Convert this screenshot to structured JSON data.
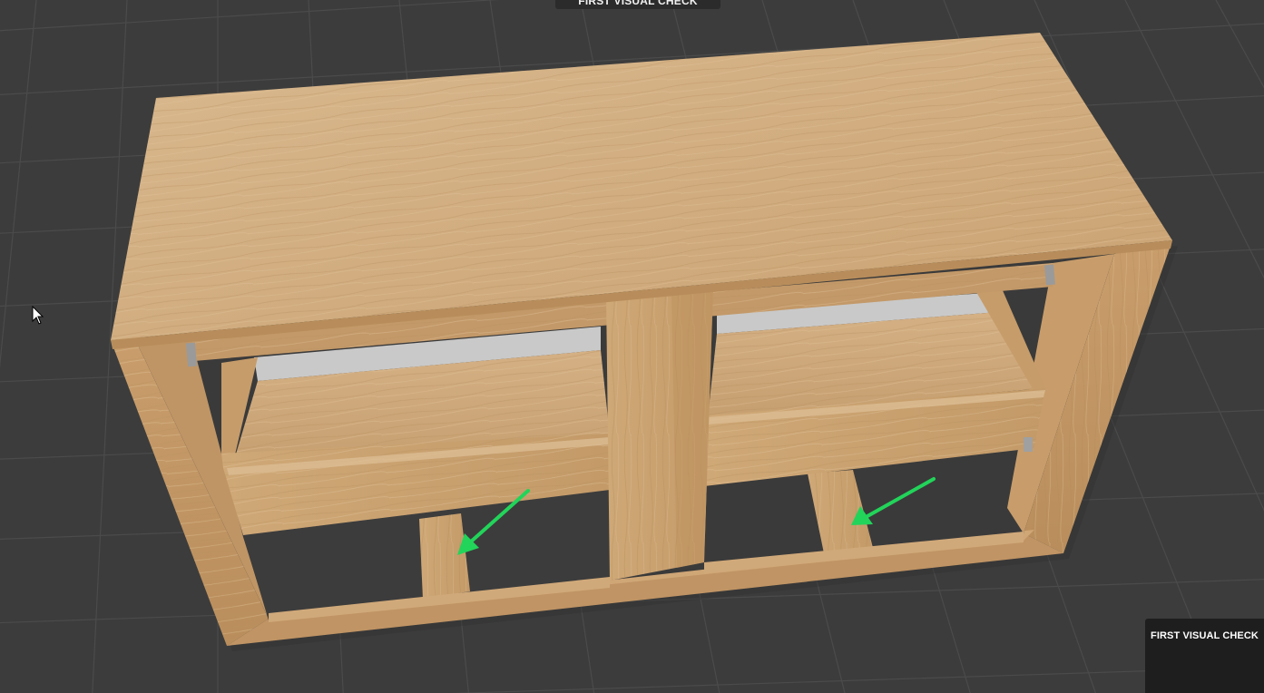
{
  "header": {
    "title": "FIRST VISUAL CHECK"
  },
  "panel": {
    "title": "FIRST VISUAL CHECK"
  },
  "scene": {
    "object": "wooden-cabinet-with-two-drawers",
    "annotations": [
      "green-arrow-left",
      "green-arrow-right"
    ],
    "colors": {
      "background": "#3c3c3c",
      "grid_line": "#4c4c4c",
      "wood_light": "#d7b488",
      "wood_mid": "#c79d6c",
      "wood_dark": "#b48a58",
      "arrow": "#22d45a",
      "panel_bg": "#1e1e1e"
    }
  }
}
